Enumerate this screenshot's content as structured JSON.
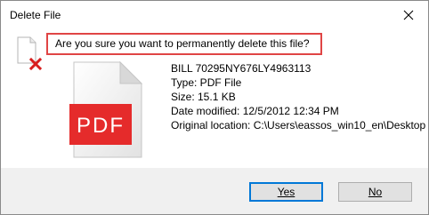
{
  "window": {
    "title": "Delete File"
  },
  "dialog": {
    "question": "Are you sure you want to permanently delete this file?",
    "file": {
      "name": "BILL 70295NY676LY4963113",
      "type": "Type: PDF File",
      "size": "Size: 15.1 KB",
      "date_modified": "Date modified: 12/5/2012 12:34 PM",
      "original_location": "Original location: C:\\Users\\eassos_win10_en\\Desktop"
    },
    "icon_label": "PDF"
  },
  "buttons": {
    "yes_label": "Yes",
    "no_label": "No"
  },
  "icons": {
    "close": "close-icon",
    "delete_file": "file-delete-icon",
    "pdf": "pdf-file-icon"
  },
  "colors": {
    "highlight_border": "#e04545",
    "pdf_red": "#e52b2b",
    "default_button_border": "#0078d7",
    "footer_bg": "#f0f0f0"
  }
}
